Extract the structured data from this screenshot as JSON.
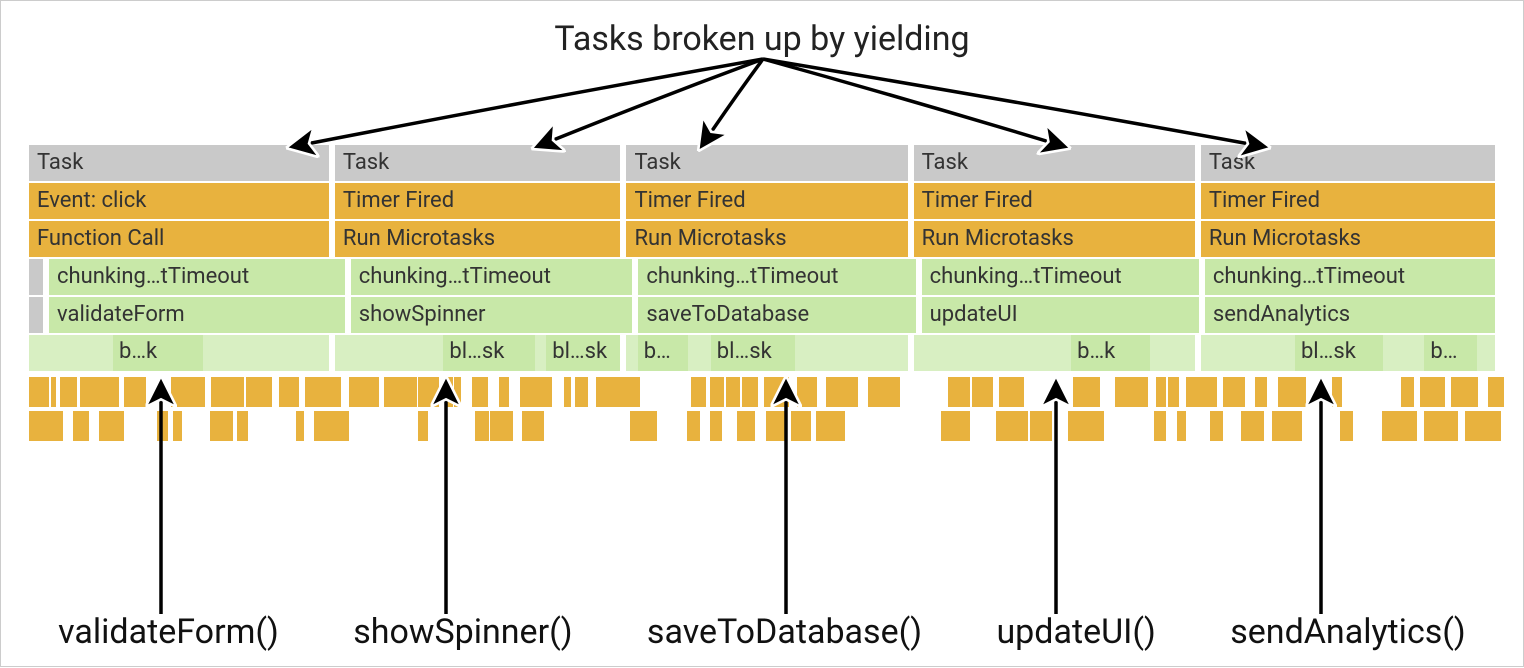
{
  "title": "Tasks broken up by yielding",
  "columns": [
    {
      "task": "Task",
      "event": "Event: click",
      "call": "Function Call",
      "chunk": "chunking…tTimeout",
      "fn": "validateForm",
      "label": "validateForm()"
    },
    {
      "task": "Task",
      "event": "Timer Fired",
      "call": "Run Microtasks",
      "chunk": "chunking…tTimeout",
      "fn": "showSpinner",
      "label": "showSpinner()"
    },
    {
      "task": "Task",
      "event": "Timer Fired",
      "call": "Run Microtasks",
      "chunk": "chunking…tTimeout",
      "fn": "saveToDatabase",
      "label": "saveToDatabase()"
    },
    {
      "task": "Task",
      "event": "Timer Fired",
      "call": "Run Microtasks",
      "chunk": "chunking…tTimeout",
      "fn": "updateUI",
      "label": "updateUI()"
    },
    {
      "task": "Task",
      "event": "Timer Fired",
      "call": "Run Microtasks",
      "chunk": "chunking…tTimeout",
      "fn": "sendAnalytics",
      "label": "sendAnalytics()"
    }
  ],
  "fragments": {
    "bk": "b…k",
    "blsk": "bl…sk",
    "b": "b…"
  },
  "colors": {
    "task_bg": "#c9c9c9",
    "event_bg": "#e8b23e",
    "fn_bg": "#c8e8a8"
  },
  "widths_pct": [
    20.8,
    19.8,
    19.5,
    19.5,
    20.4
  ]
}
